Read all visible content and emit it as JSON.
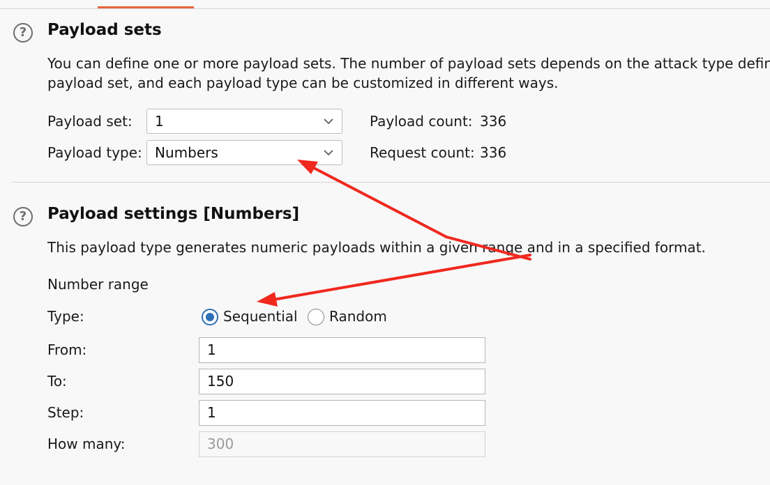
{
  "payload_sets": {
    "title": "Payload sets",
    "description_line1": "You can define one or more payload sets. The number of payload sets depends on the attack type defin",
    "description_line2": "payload set, and each payload type can be customized in different ways.",
    "payload_set_label": "Payload set:",
    "payload_set_value": "1",
    "payload_type_label": "Payload type:",
    "payload_type_value": "Numbers",
    "payload_count_label": "Payload count:",
    "payload_count_value": "336",
    "request_count_label": "Request count:",
    "request_count_value": "336"
  },
  "payload_settings": {
    "title": "Payload settings [Numbers]",
    "description": "This payload type generates numeric payloads within a given range and in a specified format.",
    "number_range_label": "Number range",
    "type_label": "Type:",
    "sequential_label": "Sequential",
    "random_label": "Random",
    "selected_type": "Sequential",
    "from_label": "From:",
    "from_value": "1",
    "to_label": "To:",
    "to_value": "150",
    "step_label": "Step:",
    "step_value": "1",
    "how_many_label": "How many:",
    "how_many_placeholder": "300"
  },
  "icons": {
    "help": "question-circle-icon",
    "dropdown": "chevron-down-icon"
  },
  "colors": {
    "accent_tab": "#e8663d",
    "radio_selected": "#2c6fb5",
    "annotation_arrow": "#f0281e"
  }
}
